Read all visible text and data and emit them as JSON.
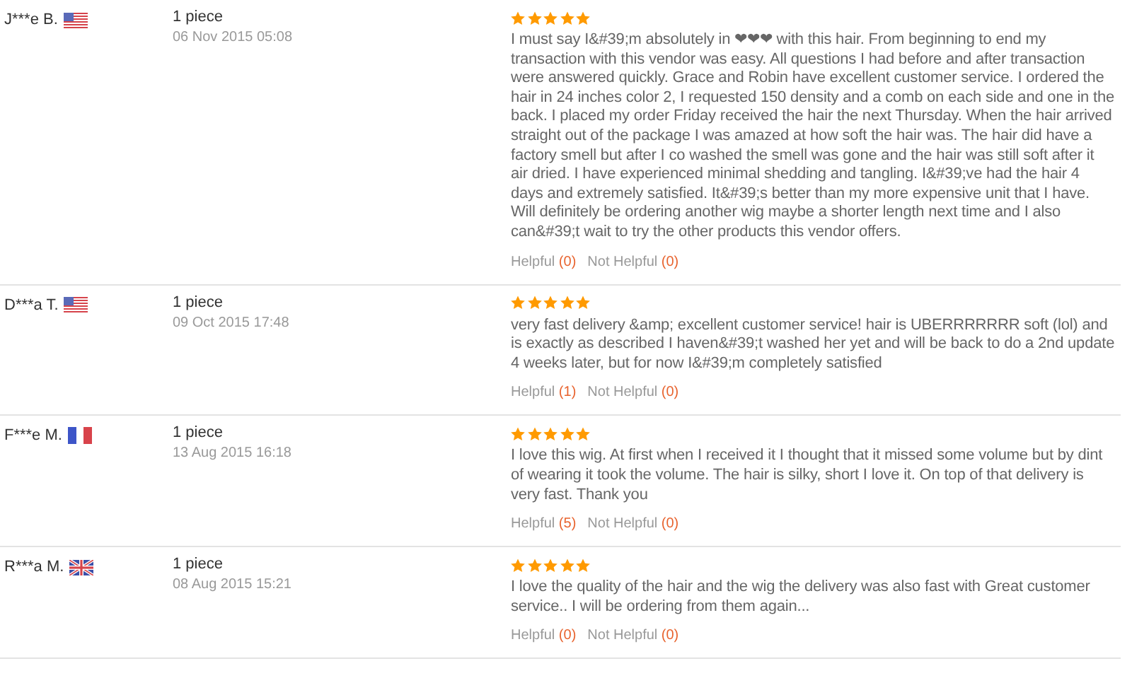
{
  "reviews": [
    {
      "name": "J***e B.",
      "flag": {
        "kind": "us"
      },
      "quantity": "1 piece",
      "date": "06 Nov 2015 05:08",
      "stars": 5,
      "text": "I must say I&#39;m absolutely in ❤❤❤ with this hair. From beginning to end my transaction with this vendor was easy. All questions I had before and after transaction were answered quickly. Grace and Robin have excellent customer service. I ordered the hair in 24 inches color 2, I requested 150 density and a comb on each side and one in the back. I placed my order Friday received the hair the next Thursday. When the hair arrived straight out of the package I was amazed at how soft the hair was. The hair did have a factory smell but after I co washed the smell was gone and the hair was still soft after it air dried. I have experienced minimal shedding and tangling. I&#39;ve had the hair 4 days and extremely satisfied. It&#39;s better than my more expensive unit that I have. Will definitely be ordering another wig maybe a shorter length next time and I also can&#39;t wait to try the other products this vendor offers.",
      "helpful": {
        "label": "Helpful",
        "count": "(0)"
      },
      "not_helpful": {
        "label": "Not Helpful",
        "count": "(0)"
      }
    },
    {
      "name": "D***a T.",
      "flag": {
        "kind": "us"
      },
      "quantity": "1 piece",
      "date": "09 Oct 2015 17:48",
      "stars": 5,
      "text": "very fast delivery &amp; excellent customer service! hair is UBERRRRRRR soft (lol) and is exactly as described I haven&#39;t washed her yet and will be back to do a 2nd update 4 weeks later, but for now I&#39;m completely satisfied",
      "helpful": {
        "label": "Helpful",
        "count": "(1)"
      },
      "not_helpful": {
        "label": "Not Helpful",
        "count": "(0)"
      }
    },
    {
      "name": "F***e M.",
      "flag": {
        "kind": "fr"
      },
      "quantity": "1 piece",
      "date": "13 Aug 2015 16:18",
      "stars": 5,
      "text": "I love this wig. At first when I received it I thought that it missed some volume but by dint of wearing it took the volume. The hair is silky, short I love it. On top of that delivery is very fast. Thank you",
      "helpful": {
        "label": "Helpful",
        "count": "(5)"
      },
      "not_helpful": {
        "label": "Not Helpful",
        "count": "(0)"
      }
    },
    {
      "name": "R***a M.",
      "flag": {
        "kind": "gb"
      },
      "quantity": "1 piece",
      "date": "08 Aug 2015 15:21",
      "stars": 5,
      "text": "I love the quality of the hair and the wig the delivery was also fast with Great customer service.. I will be ordering from them again...",
      "helpful": {
        "label": "Helpful",
        "count": "(0)"
      },
      "not_helpful": {
        "label": "Not Helpful",
        "count": "(0)"
      }
    }
  ]
}
